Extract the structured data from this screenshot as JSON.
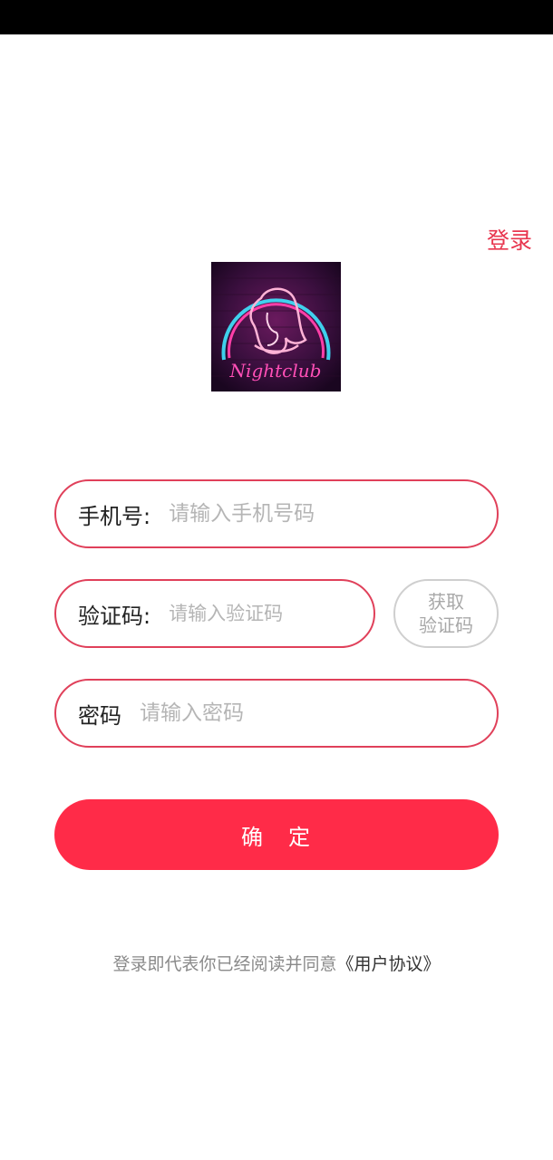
{
  "header": {
    "login_link": "登录"
  },
  "logo": {
    "text": "Nightclub"
  },
  "form": {
    "phone": {
      "label": "手机号:",
      "placeholder": "请输入手机号码"
    },
    "code": {
      "label": "验证码:",
      "placeholder": "请输入验证码"
    },
    "get_code_button": "获取\n验证码",
    "password": {
      "label": "密码",
      "placeholder": "请输入密码"
    },
    "confirm_button": "确　定"
  },
  "agreement": {
    "prefix": "登录即代表你已经阅读并同意",
    "link": "《用户协议》"
  },
  "colors": {
    "accent": "#ff2b48",
    "border": "#e0405a",
    "link": "#e8364f"
  }
}
